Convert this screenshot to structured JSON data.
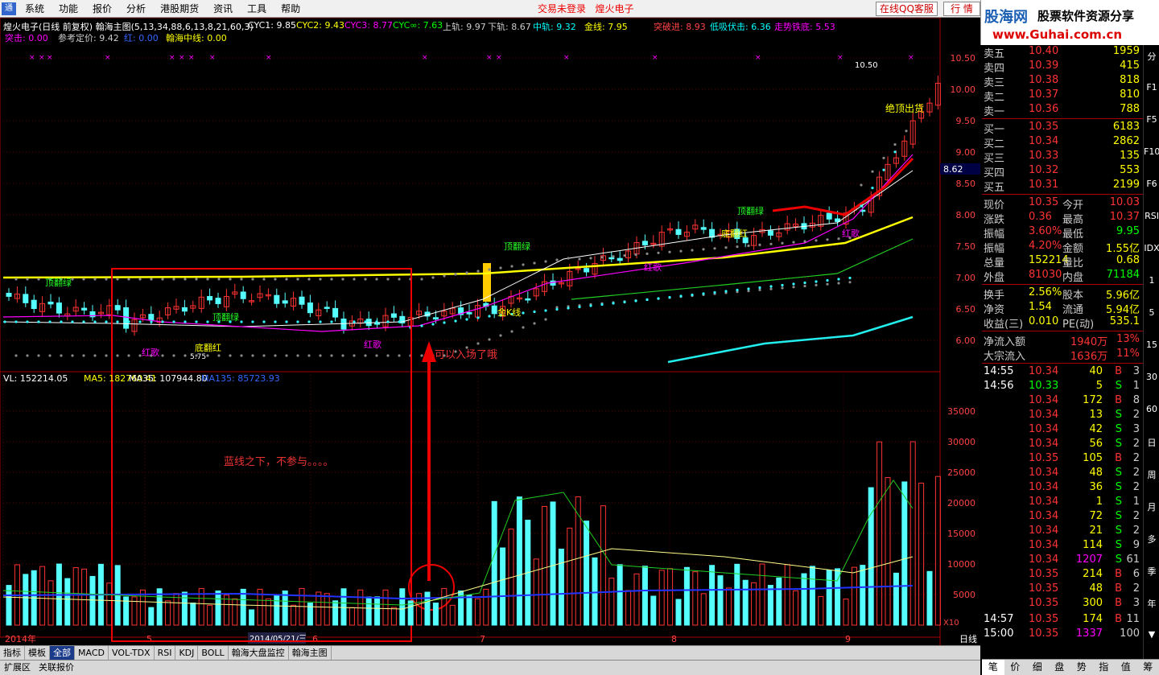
{
  "menu": {
    "items": [
      "系统",
      "功能",
      "报价",
      "分析",
      "港股期货",
      "资讯",
      "工具",
      "帮助"
    ],
    "status": "交易未登录",
    "company": "煌火电子",
    "qq": "在线QQ客服",
    "hq": "行 情"
  },
  "brand": {
    "line1": "股海网",
    "line2": "股票软件资源分享",
    "line3": "www.Guhai.com.cn"
  },
  "indicator": {
    "title": "煌火电子(日线 前复权) 翰海主图(5,13,34,88,6,13,8,21,60,3)",
    "cyc1": "CYC1: 9.85",
    "cyc2": "CYC2: 9.43",
    "cyc3": "CYC3: 8.77",
    "cycinf": "CYC∞: 7.63",
    "up": "上轨: 9.97",
    "down": "下轨: 8.67",
    "mid": "中轨: 9.32",
    "gold": "金线: 7.95",
    "breakin": "突破进: 8.93",
    "lowbuy": "低吸伏击: 6.36",
    "trend": "走势铁底: 5.53",
    "tuji": "突击: 0.00",
    "ref": "参考定价: 9.42",
    "red": "红: 0.00",
    "hanhai": "翰海中线: 0.00"
  },
  "vol": {
    "vl": "VL: 152214.05",
    "ma5": "MA5: 182760.41",
    "ma35": "MA35: 107944.80",
    "ma135": "MA135: 85723.93"
  },
  "axis": {
    "price": [
      "10.50",
      "10.00",
      "9.50",
      "9.00",
      "8.50",
      "8.00",
      "7.50",
      "7.00",
      "6.50",
      "6.00"
    ],
    "vol": [
      "35000",
      "30000",
      "25000",
      "20000",
      "15000",
      "10000",
      "5000"
    ],
    "months": [
      "2014年",
      "5",
      "6",
      "7",
      "8",
      "9"
    ],
    "date_label": "2014/05/21/三",
    "cur_price": "8.62",
    "x10": "X10",
    "daily": "日线"
  },
  "annotations": {
    "blue_below": "蓝线之下，不参与。。。。",
    "can_enter": "可以入场了哦",
    "sell": "绝顶出货",
    "gold_k": "金K线",
    "peak": "10.50",
    "top_green": "顶翻绿",
    "bottom_red": "底翻红",
    "red_song": "红歌",
    "low_label": "5.75"
  },
  "quotes": {
    "asks": [
      [
        "卖五",
        "10.40",
        "1959"
      ],
      [
        "卖四",
        "10.39",
        "415"
      ],
      [
        "卖三",
        "10.38",
        "818"
      ],
      [
        "卖二",
        "10.37",
        "810"
      ],
      [
        "卖一",
        "10.36",
        "788"
      ]
    ],
    "bids": [
      [
        "买一",
        "10.35",
        "6183"
      ],
      [
        "买二",
        "10.34",
        "2862"
      ],
      [
        "买三",
        "10.33",
        "135"
      ],
      [
        "买四",
        "10.32",
        "553"
      ],
      [
        "买五",
        "10.31",
        "2199"
      ]
    ],
    "stats": [
      [
        "现价",
        "10.35",
        "今开",
        "10.03"
      ],
      [
        "涨跌",
        "0.36",
        "最高",
        "10.37"
      ],
      [
        "振幅",
        "3.60%",
        "最低",
        "9.95"
      ],
      [
        "振幅",
        "4.20%",
        "金额",
        "1.55亿"
      ],
      [
        "总量",
        "152214",
        "量比",
        "0.68"
      ],
      [
        "外盘",
        "81030",
        "内盘",
        "71184"
      ],
      [
        "换手",
        "2.56%",
        "股本",
        "5.96亿"
      ],
      [
        "净资",
        "1.54",
        "流通",
        "5.94亿"
      ],
      [
        "收益(三)",
        "0.010",
        "PE(动)",
        "535.1"
      ]
    ],
    "flows": [
      [
        "净流入额",
        "1940万",
        "13%"
      ],
      [
        "大宗流入",
        "1636万",
        "11%"
      ]
    ]
  },
  "ticks": [
    [
      "14:55",
      "10.34",
      "40",
      "B",
      "3"
    ],
    [
      "14:56",
      "10.33",
      "5",
      "S",
      "1"
    ],
    [
      "",
      "10.34",
      "172",
      "B",
      "8"
    ],
    [
      "",
      "10.34",
      "13",
      "S",
      "2"
    ],
    [
      "",
      "10.34",
      "42",
      "S",
      "3"
    ],
    [
      "",
      "10.34",
      "56",
      "S",
      "2"
    ],
    [
      "",
      "10.35",
      "105",
      "B",
      "2"
    ],
    [
      "",
      "10.34",
      "48",
      "S",
      "2"
    ],
    [
      "",
      "10.34",
      "36",
      "S",
      "2"
    ],
    [
      "",
      "10.34",
      "1",
      "S",
      "1"
    ],
    [
      "",
      "10.34",
      "72",
      "S",
      "2"
    ],
    [
      "",
      "10.34",
      "21",
      "S",
      "2"
    ],
    [
      "",
      "10.34",
      "114",
      "S",
      "9"
    ],
    [
      "",
      "10.34",
      "1207",
      "S",
      "61"
    ],
    [
      "",
      "10.35",
      "214",
      "B",
      "6"
    ],
    [
      "",
      "10.35",
      "48",
      "B",
      "2"
    ],
    [
      "",
      "10.35",
      "300",
      "B",
      "3"
    ],
    [
      "14:57",
      "10.35",
      "174",
      "B",
      "11"
    ],
    [
      "15:00",
      "10.35",
      "1337",
      "",
      "100"
    ]
  ],
  "tabs": [
    "指标",
    "模板",
    "全部",
    "MACD",
    "VOL-TDX",
    "RSI",
    "KDJ",
    "BOLL",
    "翰海大盘监控",
    "翰海主图"
  ],
  "tabs2": [
    "扩展区",
    "关联报价"
  ],
  "right_tabs": [
    "笔",
    "价",
    "细",
    "盘",
    "势",
    "指",
    "值",
    "筹"
  ],
  "side_icons": [
    "分",
    "F1",
    "F5",
    "F10",
    "F6",
    "RSI",
    "IDX",
    "1",
    "5",
    "15",
    "30",
    "60",
    "日",
    "周",
    "月",
    "多",
    "季",
    "年",
    "▼"
  ]
}
